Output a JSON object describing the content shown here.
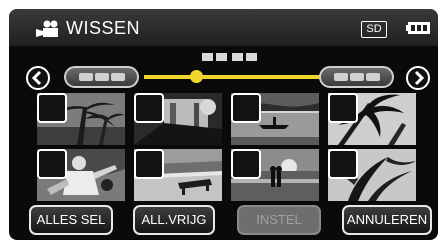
{
  "header": {
    "title": "WISSEN",
    "storage": "SD",
    "mode_icon": "video-camera-icon",
    "battery_icon": "battery-icon"
  },
  "navigation": {
    "prev_icon": "chevron-left-icon",
    "next_icon": "chevron-right-icon",
    "slider_position": 0.3,
    "accent_color": "#f0d62c"
  },
  "thumbnails": [
    {
      "scene": "palm-trees",
      "checked": false
    },
    {
      "scene": "dark-interior",
      "checked": false
    },
    {
      "scene": "boat-on-water",
      "checked": false
    },
    {
      "scene": "palm-fronds",
      "checked": false
    },
    {
      "scene": "people-outdoor",
      "checked": false
    },
    {
      "scene": "beach-bench",
      "checked": false
    },
    {
      "scene": "sunset-couple",
      "checked": false
    },
    {
      "scene": "leaves",
      "checked": false
    }
  ],
  "buttons": {
    "select_all": "ALLES SEL",
    "deselect_all": "ALL.VRIJG",
    "set": "INSTEL",
    "cancel": "ANNULEREN"
  }
}
